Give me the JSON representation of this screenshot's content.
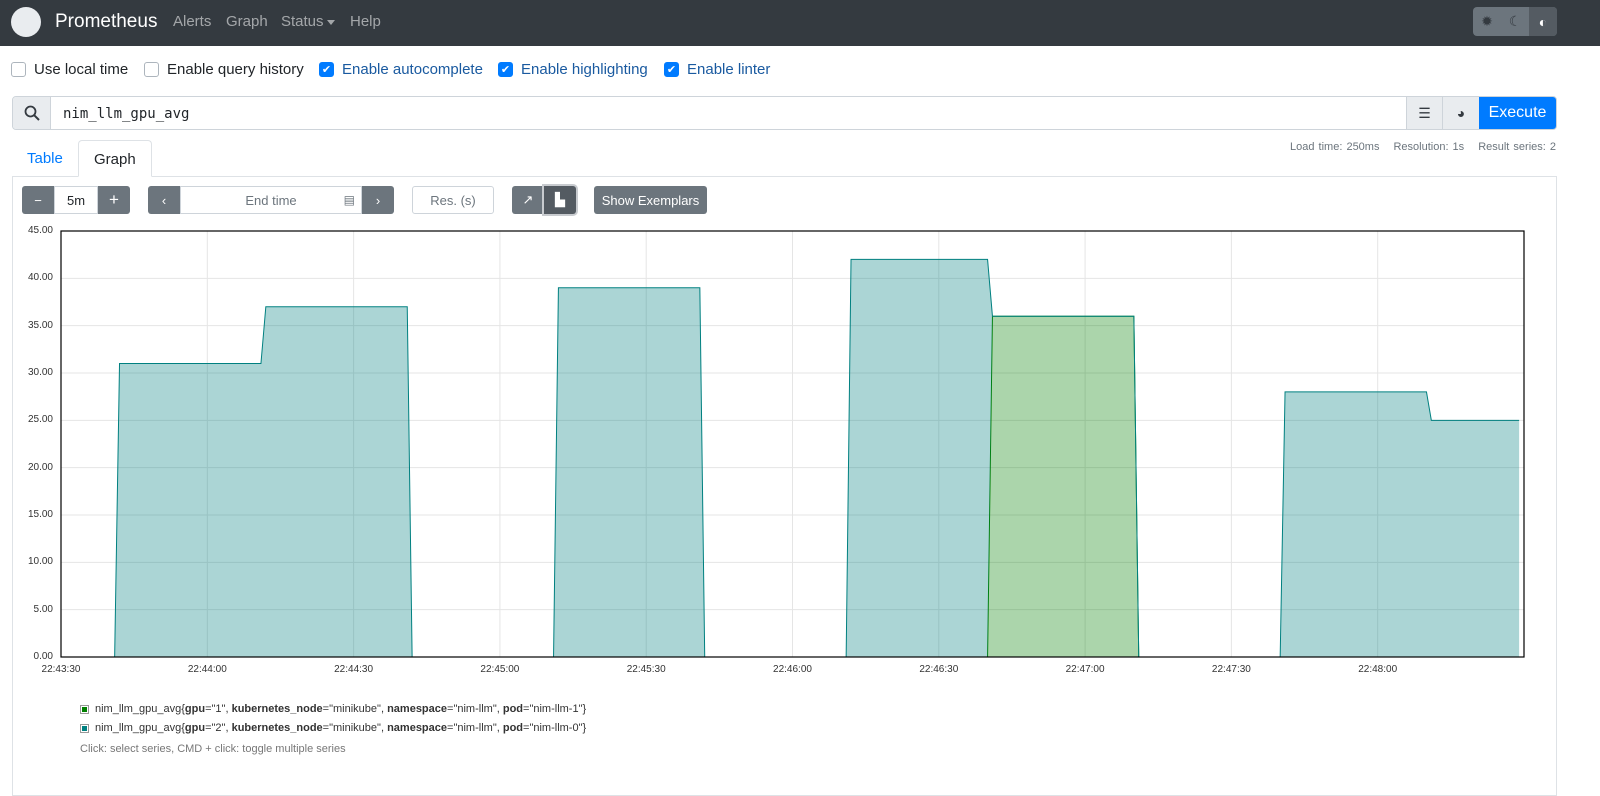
{
  "navbar": {
    "brand": "Prometheus",
    "links": [
      "Alerts",
      "Graph",
      "Status",
      "Help"
    ],
    "theme_icons": [
      "gear-icon",
      "moon-icon",
      "half-circle-icon"
    ]
  },
  "options": [
    {
      "label": "Use local time",
      "checked": false
    },
    {
      "label": "Enable query history",
      "checked": false
    },
    {
      "label": "Enable autocomplete",
      "checked": true
    },
    {
      "label": "Enable highlighting",
      "checked": true
    },
    {
      "label": "Enable linter",
      "checked": true
    }
  ],
  "query": {
    "value": "nim_llm_gpu_avg",
    "execute_label": "Execute"
  },
  "stats": {
    "load_time": "Load time: 250ms",
    "resolution": "Resolution: 1s",
    "result_series": "Result series: 2"
  },
  "tabs": {
    "table": "Table",
    "graph": "Graph"
  },
  "controls": {
    "range": "5m",
    "end_time_placeholder": "End time",
    "res_placeholder": "Res. (s)",
    "exemplars": "Show Exemplars",
    "stacked": true
  },
  "legend": {
    "series": [
      {
        "metric": "nim_llm_gpu_avg",
        "labels": [
          [
            "gpu",
            "1"
          ],
          [
            "kubernetes_node",
            "minikube"
          ],
          [
            "namespace",
            "nim-llm"
          ],
          [
            "pod",
            "nim-llm-1"
          ]
        ],
        "color": "#008000"
      },
      {
        "metric": "nim_llm_gpu_avg",
        "labels": [
          [
            "gpu",
            "2"
          ],
          [
            "kubernetes_node",
            "minikube"
          ],
          [
            "namespace",
            "nim-llm"
          ],
          [
            "pod",
            "nim-llm-0"
          ]
        ],
        "color": "#008080"
      }
    ],
    "hint": "Click: select series, CMD + click: toggle multiple series"
  },
  "chart_data": {
    "type": "area",
    "stacked": true,
    "x_range": [
      "22:43:30",
      "22:48:29"
    ],
    "ylim": [
      0,
      45
    ],
    "y_ticks": [
      "0.00",
      "5.00",
      "10.00",
      "15.00",
      "20.00",
      "25.00",
      "30.00",
      "35.00",
      "40.00",
      "45.00"
    ],
    "x_ticks": [
      "22:43:30",
      "22:44:00",
      "22:44:30",
      "22:45:00",
      "22:45:30",
      "22:46:00",
      "22:46:30",
      "22:47:00",
      "22:47:30",
      "22:48:00"
    ],
    "grid": true,
    "series": [
      {
        "name": "nim_llm_gpu_avg{gpu=\"1\", kubernetes_node=\"minikube\", namespace=\"nim-llm\", pod=\"nim-llm-1\"}",
        "color": "#008000",
        "segments": [
          {
            "from": "22:46:41",
            "to": "22:47:10",
            "value": 36
          }
        ],
        "default": 0
      },
      {
        "name": "nim_llm_gpu_avg{gpu=\"2\", kubernetes_node=\"minikube\", namespace=\"nim-llm\", pod=\"nim-llm-0\"}",
        "color": "#008080",
        "segments": [
          {
            "from": "22:43:42",
            "to": "22:44:11",
            "value": 31
          },
          {
            "from": "22:44:12",
            "to": "22:44:41",
            "value": 37
          },
          {
            "from": "22:45:12",
            "to": "22:45:41",
            "value": 39
          },
          {
            "from": "22:46:12",
            "to": "22:46:40",
            "value": 42
          },
          {
            "from": "22:47:41",
            "to": "22:48:10",
            "value": 28
          },
          {
            "from": "22:48:11",
            "to": "22:48:29",
            "value": 25
          }
        ],
        "default": 0
      }
    ]
  }
}
